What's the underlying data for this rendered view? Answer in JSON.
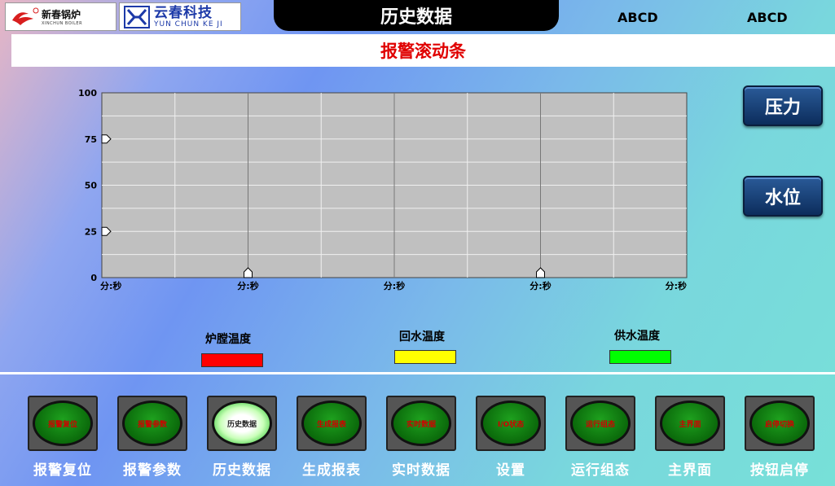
{
  "header": {
    "logo1": {
      "name": "新春锅炉",
      "sub": "XINCHUN BOILER"
    },
    "logo2": {
      "name": "云春科技",
      "sub": "YUN CHUN KE JI"
    },
    "title": "历史数据",
    "user1": "ABCD",
    "user2": "ABCD"
  },
  "alarm_scroll": {
    "text": "报警滚动条"
  },
  "side_buttons": {
    "pressure": "压力",
    "water_level": "水位"
  },
  "chart_data": {
    "type": "line",
    "title": "",
    "ylim": [
      0,
      100
    ],
    "y_ticks": [
      "0",
      "25",
      "50",
      "75",
      "100"
    ],
    "x_tick_labels": [
      "分:秒",
      "分:秒",
      "分:秒",
      "分:秒",
      "分:秒"
    ],
    "x_tick_positions": [
      0,
      0.25,
      0.5,
      0.75,
      1.0
    ],
    "y_markers": [
      75,
      25
    ],
    "x_markers": [
      0.25,
      0.75
    ],
    "grid": true,
    "background": "#c0c0c0",
    "series": []
  },
  "legend": [
    {
      "label": "炉膛温度",
      "color": "#ff0000"
    },
    {
      "label": "回水温度",
      "color": "#ffff00"
    },
    {
      "label": "供水温度",
      "color": "#00ff00"
    }
  ],
  "bottom_buttons": [
    {
      "lamp_text": "报警复位",
      "label": "报警复位",
      "lit": false
    },
    {
      "lamp_text": "报警参数",
      "label": "报警参数",
      "lit": false
    },
    {
      "lamp_text": "历史数据",
      "label": "历史数据",
      "lit": true
    },
    {
      "lamp_text": "生成报表",
      "label": "生成报表",
      "lit": false
    },
    {
      "lamp_text": "实时数据",
      "label": "实时数据",
      "lit": false
    },
    {
      "lamp_text": "I/O状态",
      "label": "设置",
      "lit": false
    },
    {
      "lamp_text": "运行组态",
      "label": "运行组态",
      "lit": false
    },
    {
      "lamp_text": "主界面",
      "label": "主界面",
      "lit": false
    },
    {
      "lamp_text": "启停切换",
      "label": "按钮启停",
      "lit": false
    }
  ],
  "colors": {
    "alarm_text": "#e00000",
    "accent": "#1d3aa8"
  }
}
